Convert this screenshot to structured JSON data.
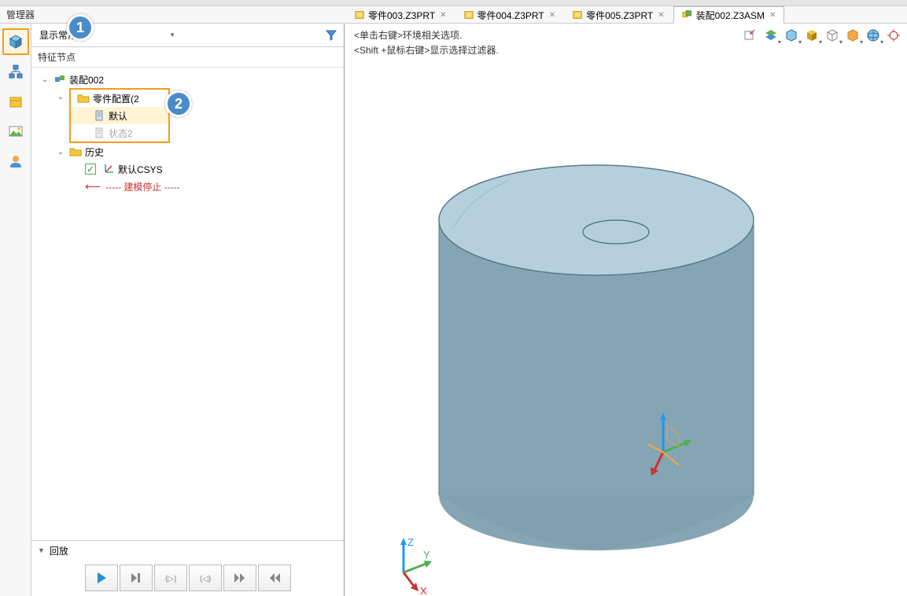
{
  "manager_title": "管理器",
  "tabs": [
    {
      "label": "零件003.Z3PRT",
      "active": false
    },
    {
      "label": "零件004.Z3PRT",
      "active": false
    },
    {
      "label": "零件005.Z3PRT",
      "active": false
    },
    {
      "label": "装配002.Z3ASM",
      "active": true
    }
  ],
  "badges": {
    "one": "1",
    "two": "2"
  },
  "display_mode": "显示常用",
  "section_header": "特征节点",
  "tree": {
    "root": "装配002",
    "config_folder": "零件配置(2",
    "config_items": [
      "默认",
      "状态2"
    ],
    "history_folder": "历史",
    "csys_item": "默认CSYS",
    "stop_text": "----- 建模停止 -----"
  },
  "playback_label": "回放",
  "viewport_hints": {
    "line1": "<单击右键>环境相关选项.",
    "line2": "<Shift +鼠标右键>显示选择过滤器."
  },
  "axis_labels": {
    "x": "X",
    "y": "Y",
    "z": "Z"
  }
}
